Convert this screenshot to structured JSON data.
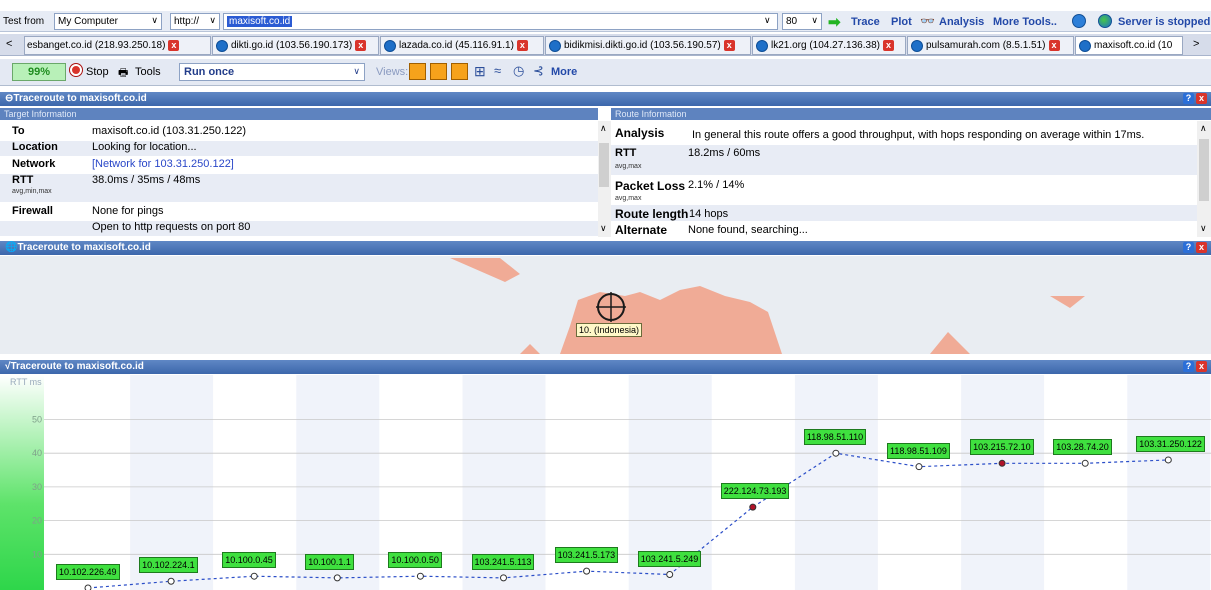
{
  "topbar": {
    "test_from_label": "Test from",
    "test_from_value": "My Computer",
    "protocol": "http://",
    "url": "maxisoft.co.id",
    "port": "80",
    "trace": "Trace",
    "plot": "Plot",
    "analysis": "Analysis",
    "more_tools": "More Tools..",
    "server_status": "Server is stopped"
  },
  "tabs": [
    {
      "label": "esbanget.co.id (218.93.250.18)"
    },
    {
      "label": "dikti.go.id (103.56.190.173)"
    },
    {
      "label": "lazada.co.id (45.116.91.1)"
    },
    {
      "label": "bidikmisi.dikti.go.id (103.56.190.57)"
    },
    {
      "label": "lk21.org (104.27.136.38)"
    },
    {
      "label": "pulsamurah.com (8.5.1.51)"
    },
    {
      "label": "maxisoft.co.id (10"
    }
  ],
  "toolbar": {
    "progress": "99%",
    "stop": "Stop",
    "tools": "Tools",
    "mode": "Run once",
    "views": "Views:",
    "more": "More"
  },
  "panel1": {
    "title": "Traceroute to maxisoft.co.id",
    "target_header": "Target Information",
    "route_header": "Route Information",
    "to_k": "To",
    "to_v": "maxisoft.co.id (103.31.250.122)",
    "loc_k": "Location",
    "loc_v": "Looking for location...",
    "net_k": "Network",
    "net_v": "[Network for 103.31.250.122]",
    "rtt_k": "RTT",
    "rtt_sub": "avg,min,max",
    "rtt_v": "38.0ms / 35ms / 48ms",
    "fw_k": "Firewall",
    "fw_v1": "None for pings",
    "fw_v2": "Open to http requests on port 80",
    "an_k": "Analysis",
    "an_v": "In general this route offers a good throughput, with hops responding on average within 17ms.",
    "rrtt_k": "RTT",
    "rrtt_sub": "avg,max",
    "rrtt_v": "18.2ms / 60ms",
    "pl_k": "Packet Loss",
    "pl_sub": "avg,max",
    "pl_v": "2.1% / 14%",
    "rl_k": "Route length",
    "rl_v": "14 hops",
    "alt_k": "Alternate",
    "alt_v": "None found, searching..."
  },
  "panel2": {
    "title": "Traceroute to maxisoft.co.id",
    "map_label": "10. (Indonesia)"
  },
  "panel3": {
    "title": "Traceroute to maxisoft.co.id",
    "y_unit": "RTT ms"
  },
  "chart_data": {
    "type": "line",
    "ylabel": "RTT ms",
    "yticks": [
      10,
      20,
      30,
      40,
      50
    ],
    "ylim": [
      0,
      60
    ],
    "hops": [
      {
        "label": "10.102.226.49",
        "rtt": 0
      },
      {
        "label": "10.102.224.1",
        "rtt": 2
      },
      {
        "label": "10.100.0.45",
        "rtt": 3.5
      },
      {
        "label": "10.100.1.1",
        "rtt": 3
      },
      {
        "label": "10.100.0.50",
        "rtt": 3.5
      },
      {
        "label": "103.241.5.113",
        "rtt": 3
      },
      {
        "label": "103.241.5.173",
        "rtt": 5
      },
      {
        "label": "103.241.5.249",
        "rtt": 4
      },
      {
        "label": "222.124.73.193",
        "rtt": 24
      },
      {
        "label": "118.98.51.110",
        "rtt": 40
      },
      {
        "label": "118.98.51.109",
        "rtt": 36
      },
      {
        "label": "103.215.72.10",
        "rtt": 37
      },
      {
        "label": "103.28.74.20",
        "rtt": 37
      },
      {
        "label": "103.31.250.122",
        "rtt": 38
      }
    ]
  },
  "colors": {
    "accent": "#3c67ab",
    "hop_label": "#3fe03f",
    "land": "#f0ab96"
  }
}
